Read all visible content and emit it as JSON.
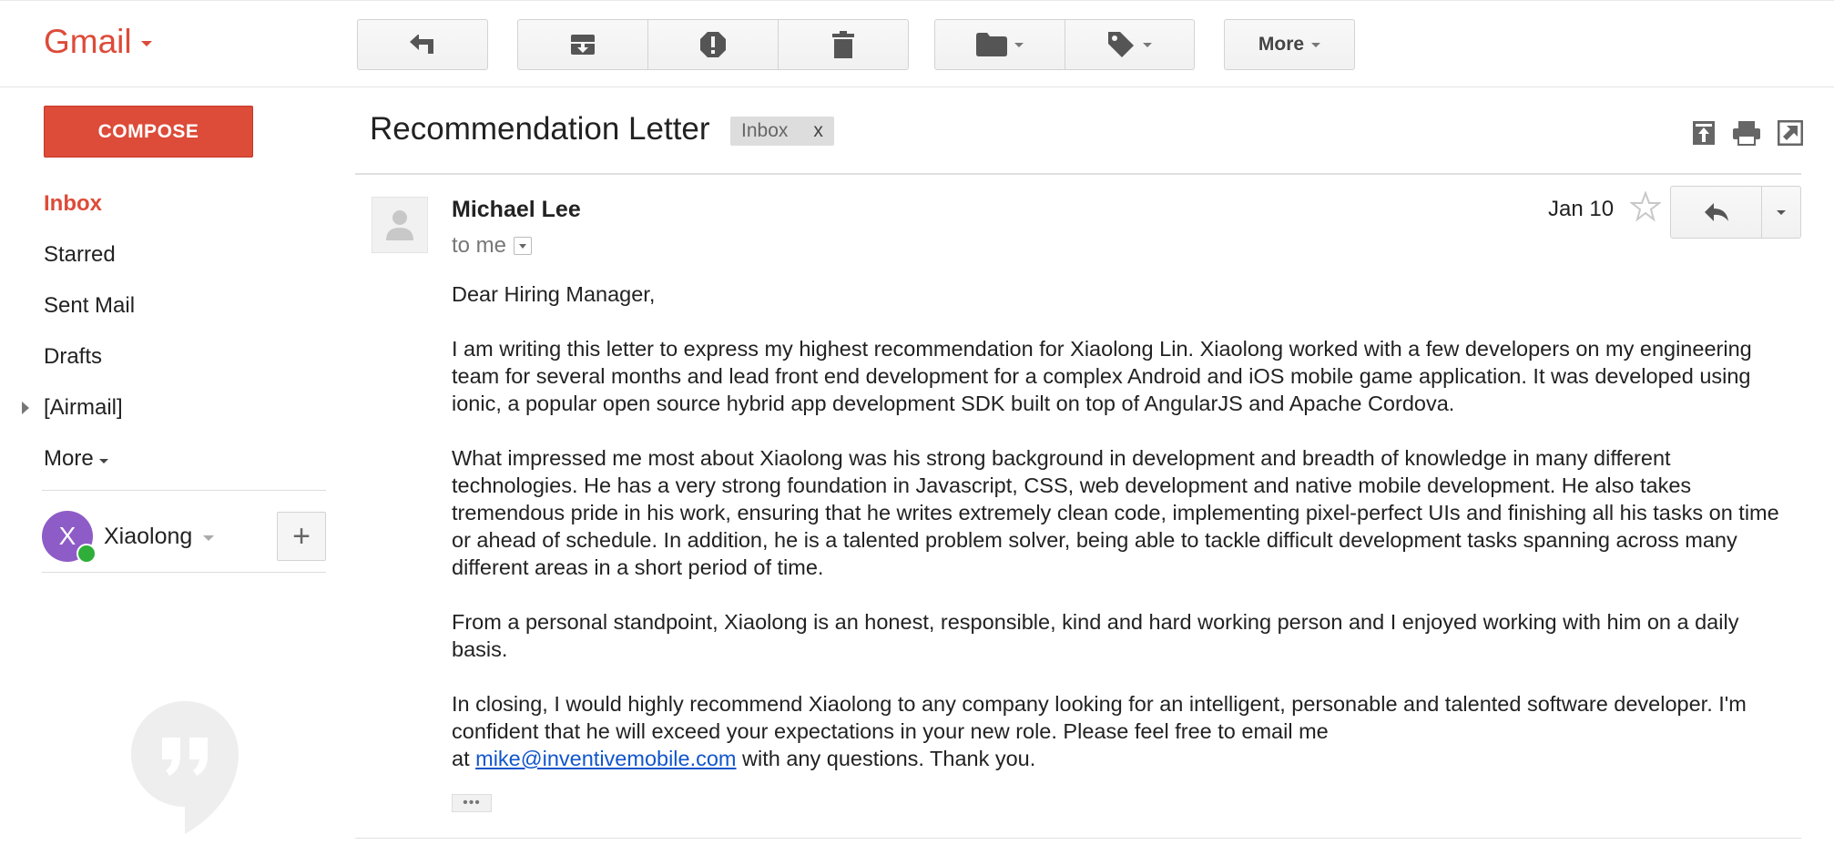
{
  "header": {
    "app_name": "Gmail",
    "toolbar": {
      "back_icon": "reply-arrow-icon",
      "archive_icon": "archive-icon",
      "spam_icon": "report-spam-icon",
      "delete_icon": "trash-icon",
      "move_icon": "folder-icon",
      "labels_icon": "label-tag-icon",
      "more_label": "More"
    }
  },
  "sidebar": {
    "compose_label": "COMPOSE",
    "items": [
      {
        "label": "Inbox"
      },
      {
        "label": "Starred"
      },
      {
        "label": "Sent Mail"
      },
      {
        "label": "Drafts"
      },
      {
        "label": "[Airmail]"
      },
      {
        "label": "More"
      }
    ],
    "account": {
      "initial": "X",
      "name": "Xiaolong",
      "add_label": "+"
    }
  },
  "thread": {
    "subject": "Recommendation Letter",
    "label_chip": "Inbox",
    "label_remove": "x",
    "message": {
      "sender": "Michael Lee",
      "recipient": "to me",
      "date": "Jan 10",
      "greeting": "Dear Hiring Manager,",
      "paragraphs": [
        "I am writing this letter to express my highest recommendation for Xiaolong Lin. Xiaolong worked with a few developers on my engineering team for several months and lead front end development for a complex Android and iOS mobile game application. It was developed using ionic, a popular open source hybrid app development SDK built on top of AngularJS and Apache Cordova.",
        "What impressed me most about Xiaolong was his strong background in development and breadth of knowledge in many different technologies. He has a very strong foundation in Javascript, CSS, web development and native mobile development. He also takes tremendous pride in his work, ensuring that he writes extremely clean code, implementing pixel-perfect UIs and finishing all his tasks on time or ahead of schedule. In addition, he is a talented problem solver, being able to tackle difficult development tasks spanning across many different areas in a short period of time.",
        "From a personal standpoint, Xiaolong is an honest, responsible, kind and hard working person and I enjoyed working with him on a daily basis.",
        "In closing, I would highly recommend Xiaolong to any company looking for an intelligent, personable and talented software developer. I'm confident that he will exceed your expectations in your new role. Please feel free to email me"
      ],
      "closing_prefix": "at",
      "email_link": "mike@inventivemobile.com",
      "closing_suffix": "with any questions. Thank you.",
      "trimmed_content": "•••"
    }
  },
  "colors": {
    "brand_red": "#dd4b39",
    "link_blue": "#1155cc",
    "avatar_purple": "#8e5cc7",
    "online_green": "#2fae3a"
  }
}
